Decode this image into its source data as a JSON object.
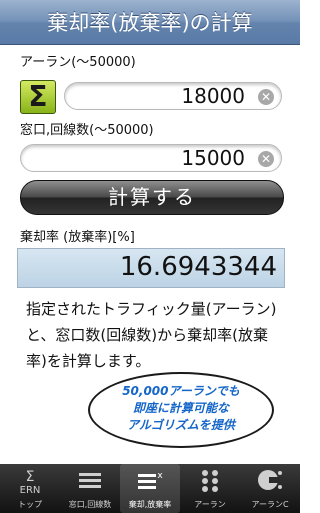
{
  "header": {
    "title": "棄却率(放棄率)の計算"
  },
  "erlang": {
    "label": "アーラン(〜50000)",
    "value": "18000",
    "sum_icon": "sigma-icon",
    "clear_icon": "clear-icon"
  },
  "windows": {
    "label": "窓口,回線数(〜50000)",
    "value": "15000",
    "clear_icon": "clear-icon"
  },
  "calculate": {
    "label": "計算する"
  },
  "result": {
    "label": "棄却率 (放棄率)[%]",
    "value": "16.6943344"
  },
  "description": "指定されたトラフィック量(アーラン)と、窓口数(回線数)から棄却率(放棄率)を計算します。",
  "bubble": {
    "lines": [
      "50,000アーランでも",
      "即座に計算可能な",
      "アルゴリズムを提供"
    ]
  },
  "tabs": [
    {
      "label": "トップ",
      "icon": "erlang-sigma-icon",
      "glyph": "Σ",
      "active": false
    },
    {
      "label": "窓口,回線数",
      "icon": "lines-icon",
      "glyph": "☰",
      "active": false
    },
    {
      "label": "棄却,放棄率",
      "icon": "abandon-rate-icon",
      "glyph": "☰",
      "active": true
    },
    {
      "label": "アーラン",
      "icon": "dots-grid-icon",
      "glyph": "⁘",
      "active": false
    },
    {
      "label": "アーランC",
      "icon": "erlang-c-icon",
      "glyph": "C",
      "active": false
    }
  ],
  "colors": {
    "header": "#6484ad",
    "sum_button": "#88b319",
    "bubble_text": "#1566c9",
    "result_bg": "#c9dcea"
  }
}
